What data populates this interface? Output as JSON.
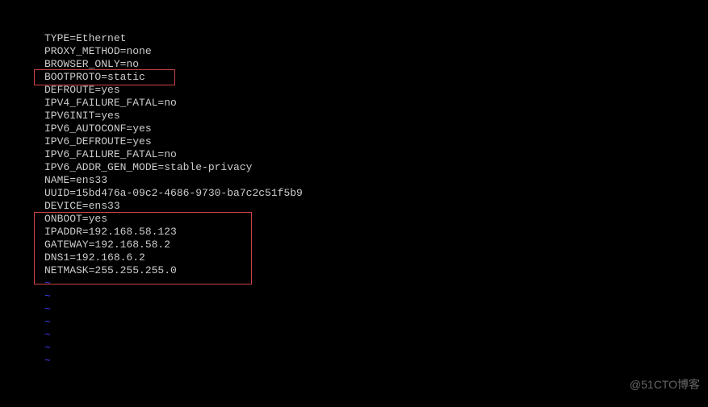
{
  "config": {
    "lines": [
      "TYPE=Ethernet",
      "PROXY_METHOD=none",
      "BROWSER_ONLY=no",
      "BOOTPROTO=static",
      "DEFROUTE=yes",
      "IPV4_FAILURE_FATAL=no",
      "IPV6INIT=yes",
      "IPV6_AUTOCONF=yes",
      "IPV6_DEFROUTE=yes",
      "IPV6_FAILURE_FATAL=no",
      "IPV6_ADDR_GEN_MODE=stable-privacy",
      "NAME=ens33",
      "UUID=15bd476a-09c2-4686-9730-ba7c2c51f5b9",
      "DEVICE=ens33",
      "ONBOOT=yes",
      "IPADDR=192.168.58.123",
      "GATEWAY=192.168.58.2",
      "DNS1=192.168.6.2",
      "NETMASK=255.255.255.0"
    ],
    "empty_line_count": 7,
    "tilde_marker": "~"
  },
  "watermark": "@51CTO博客"
}
